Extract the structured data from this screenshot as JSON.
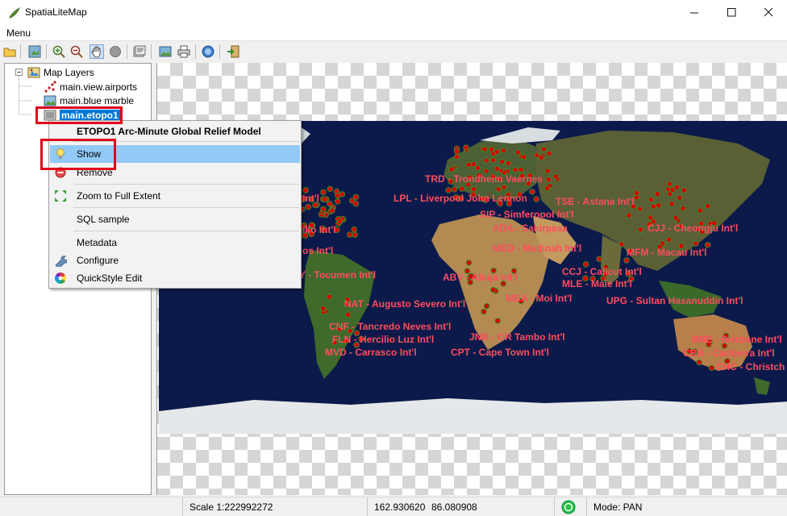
{
  "window": {
    "title": "SpatiaLiteMap"
  },
  "menu": {
    "label": "Menu"
  },
  "toolbar": {
    "buttons": [
      "open-icon",
      "layer-add-icon",
      "zoom-in-icon",
      "zoom-out-icon",
      "pan-icon",
      "identify-icon",
      "properties-icon",
      "export-image-icon",
      "print-icon",
      "info-icon",
      "exit-icon"
    ]
  },
  "tree": {
    "root": "Map Layers",
    "layers": [
      "main.view.airports",
      "main.blue marble",
      "main.etopo1"
    ]
  },
  "context_menu": {
    "title": "ETOPO1 Arc-Minute Global Relief Model",
    "items": [
      "Show",
      "Remove",
      "Zoom to Full Extent",
      "SQL sample",
      "Metadata",
      "Configure",
      "QuickStyle Edit"
    ]
  },
  "map_labels": [
    "TRD - Trondheim Vaernes",
    "LPL - Liverpool John Lennon",
    "TSE - Astana Int'l",
    "SIP - Simferopol Int'l",
    "ADA - Sakirpasa",
    "CJJ - Cheongju Int'l",
    "MED - Madinah Int'l",
    "MFM - Macau Int'l",
    "CCJ - Calicut Int'l",
    "MLE - Male Int'l",
    "ABV - Abuja Int'l",
    "Y - Tocumen Int'l",
    "NAT - Augusto Severo Int'l",
    "MBA - Moi Int'l",
    "UPG - Sultan Hasanuddin Int'l",
    "CNF - Tancredo Neves Int'l",
    "FLN - Hercilio Luz Int'l",
    "JNB - OR Tambo Int'l",
    "MVD - Carrasco Int'l",
    "CPT - Cape Town Int'l",
    "BNE - Brisbane Int'l",
    "CBR - Canberra Int'l",
    "CHC - Christch",
    "Int'l",
    "illo Int'l",
    "os Int'l"
  ],
  "status": {
    "scale": "Scale 1:222992272",
    "x": "162.930620",
    "y": "86.080908",
    "mode": "Mode: PAN"
  },
  "colors": {
    "label": "#ff4d5e",
    "point": "#d80000",
    "ocean": "#0b1a4a",
    "highlight": "#91c9f7",
    "selection": "#0078d7",
    "marker": "#e0001b"
  }
}
